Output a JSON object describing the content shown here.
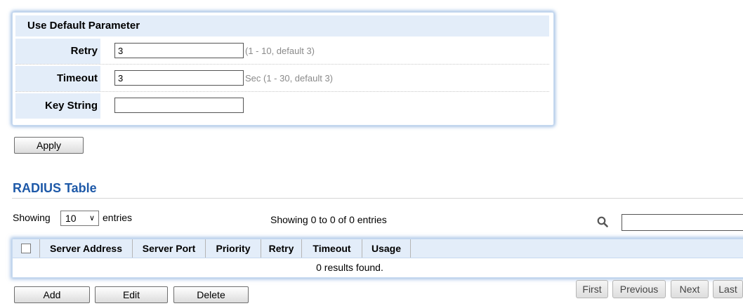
{
  "params": {
    "header": "Use Default Parameter",
    "retry": {
      "label": "Retry",
      "value": "3",
      "hint": "(1 - 10, default 3)"
    },
    "timeout": {
      "label": "Timeout",
      "value": "3",
      "hint": "Sec (1 - 30, default 3)"
    },
    "key_string": {
      "label": "Key String",
      "value": ""
    },
    "apply_label": "Apply"
  },
  "table_section": {
    "title": "RADIUS Table",
    "showing_prefix": "Showing",
    "entries_value": "10",
    "entries_suffix": "entries",
    "info": "Showing 0 to 0 of 0 entries",
    "columns": [
      "Server Address",
      "Server Port",
      "Priority",
      "Retry",
      "Timeout",
      "Usage"
    ],
    "empty_message": "0 results found.",
    "actions": {
      "add": "Add",
      "edit": "Edit",
      "delete": "Delete"
    },
    "pagination": {
      "first": "First",
      "previous": "Previous",
      "next": "Next",
      "last": "Last"
    }
  },
  "icons": {
    "search": "search-icon",
    "dropdown": "chevron-down-icon"
  }
}
